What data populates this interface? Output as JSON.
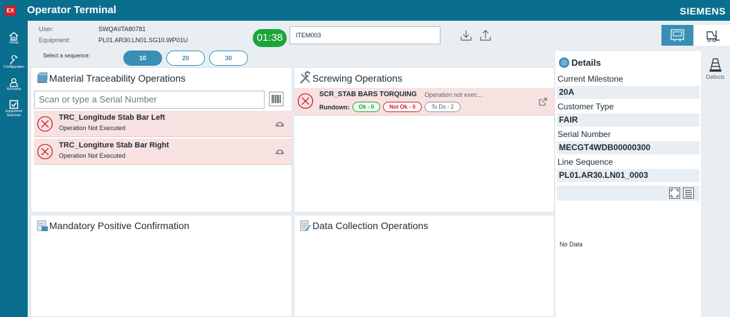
{
  "titlebar": {
    "badge": "EX",
    "title": "Operator Terminal",
    "brand": "SIEMENS"
  },
  "nav": [
    {
      "label": "Home"
    },
    {
      "label": "Configuration"
    },
    {
      "label": "Accounts"
    },
    {
      "label": "Equipment"
    },
    {
      "label": "Selection"
    }
  ],
  "header": {
    "user_label": "User:",
    "user_value": "SWQA\\ITA80781",
    "equipment_label": "Equipment:",
    "equipment_value": "PL01.AR30.LN01.SG10.WP01U",
    "timer": "01:38",
    "item": "ITEM003"
  },
  "sequence": {
    "label": "Select a sequence:",
    "options": [
      "10",
      "20",
      "30"
    ],
    "selected": "10"
  },
  "material": {
    "title": "Material Traceability Operations",
    "scan_placeholder": "Scan or type a Serial Number",
    "operations": [
      {
        "name": "TRC_Longitude Stab Bar Left",
        "status": "Operation Not Executed"
      },
      {
        "name": "TRC_Longiture Stab Bar Right",
        "status": "Operation Not Executed"
      }
    ]
  },
  "screwing": {
    "title": "Screwing Operations",
    "operation": {
      "name": "SCR_STAB BARS TORQUING",
      "note": "Operation not exec...",
      "rundown_label": "Rundown:",
      "ok": "Ok - 0",
      "not_ok": "Not Ok - 0",
      "todo": "To Do - 2"
    }
  },
  "mandatory": {
    "title": "Mandatory Positive Confirmation"
  },
  "datacollection": {
    "title": "Data Collection Operations"
  },
  "details": {
    "title": "Details",
    "fields": [
      {
        "label": "Current Milestone",
        "value": "20A"
      },
      {
        "label": "Customer Type",
        "value": "FAIR"
      },
      {
        "label": "Serial Number",
        "value": "MECGT4WDB00000300"
      },
      {
        "label": "Line Sequence",
        "value": "PL01.AR30.LN01_0003"
      }
    ],
    "no_data": "No Data"
  },
  "rightbar": {
    "defects": "Defects"
  },
  "colors": {
    "primary": "#0a6e8e",
    "accent": "#3a8fb7",
    "ok": "#1aa53a",
    "error": "#c8202e",
    "error_bg": "#f7e2e1"
  }
}
